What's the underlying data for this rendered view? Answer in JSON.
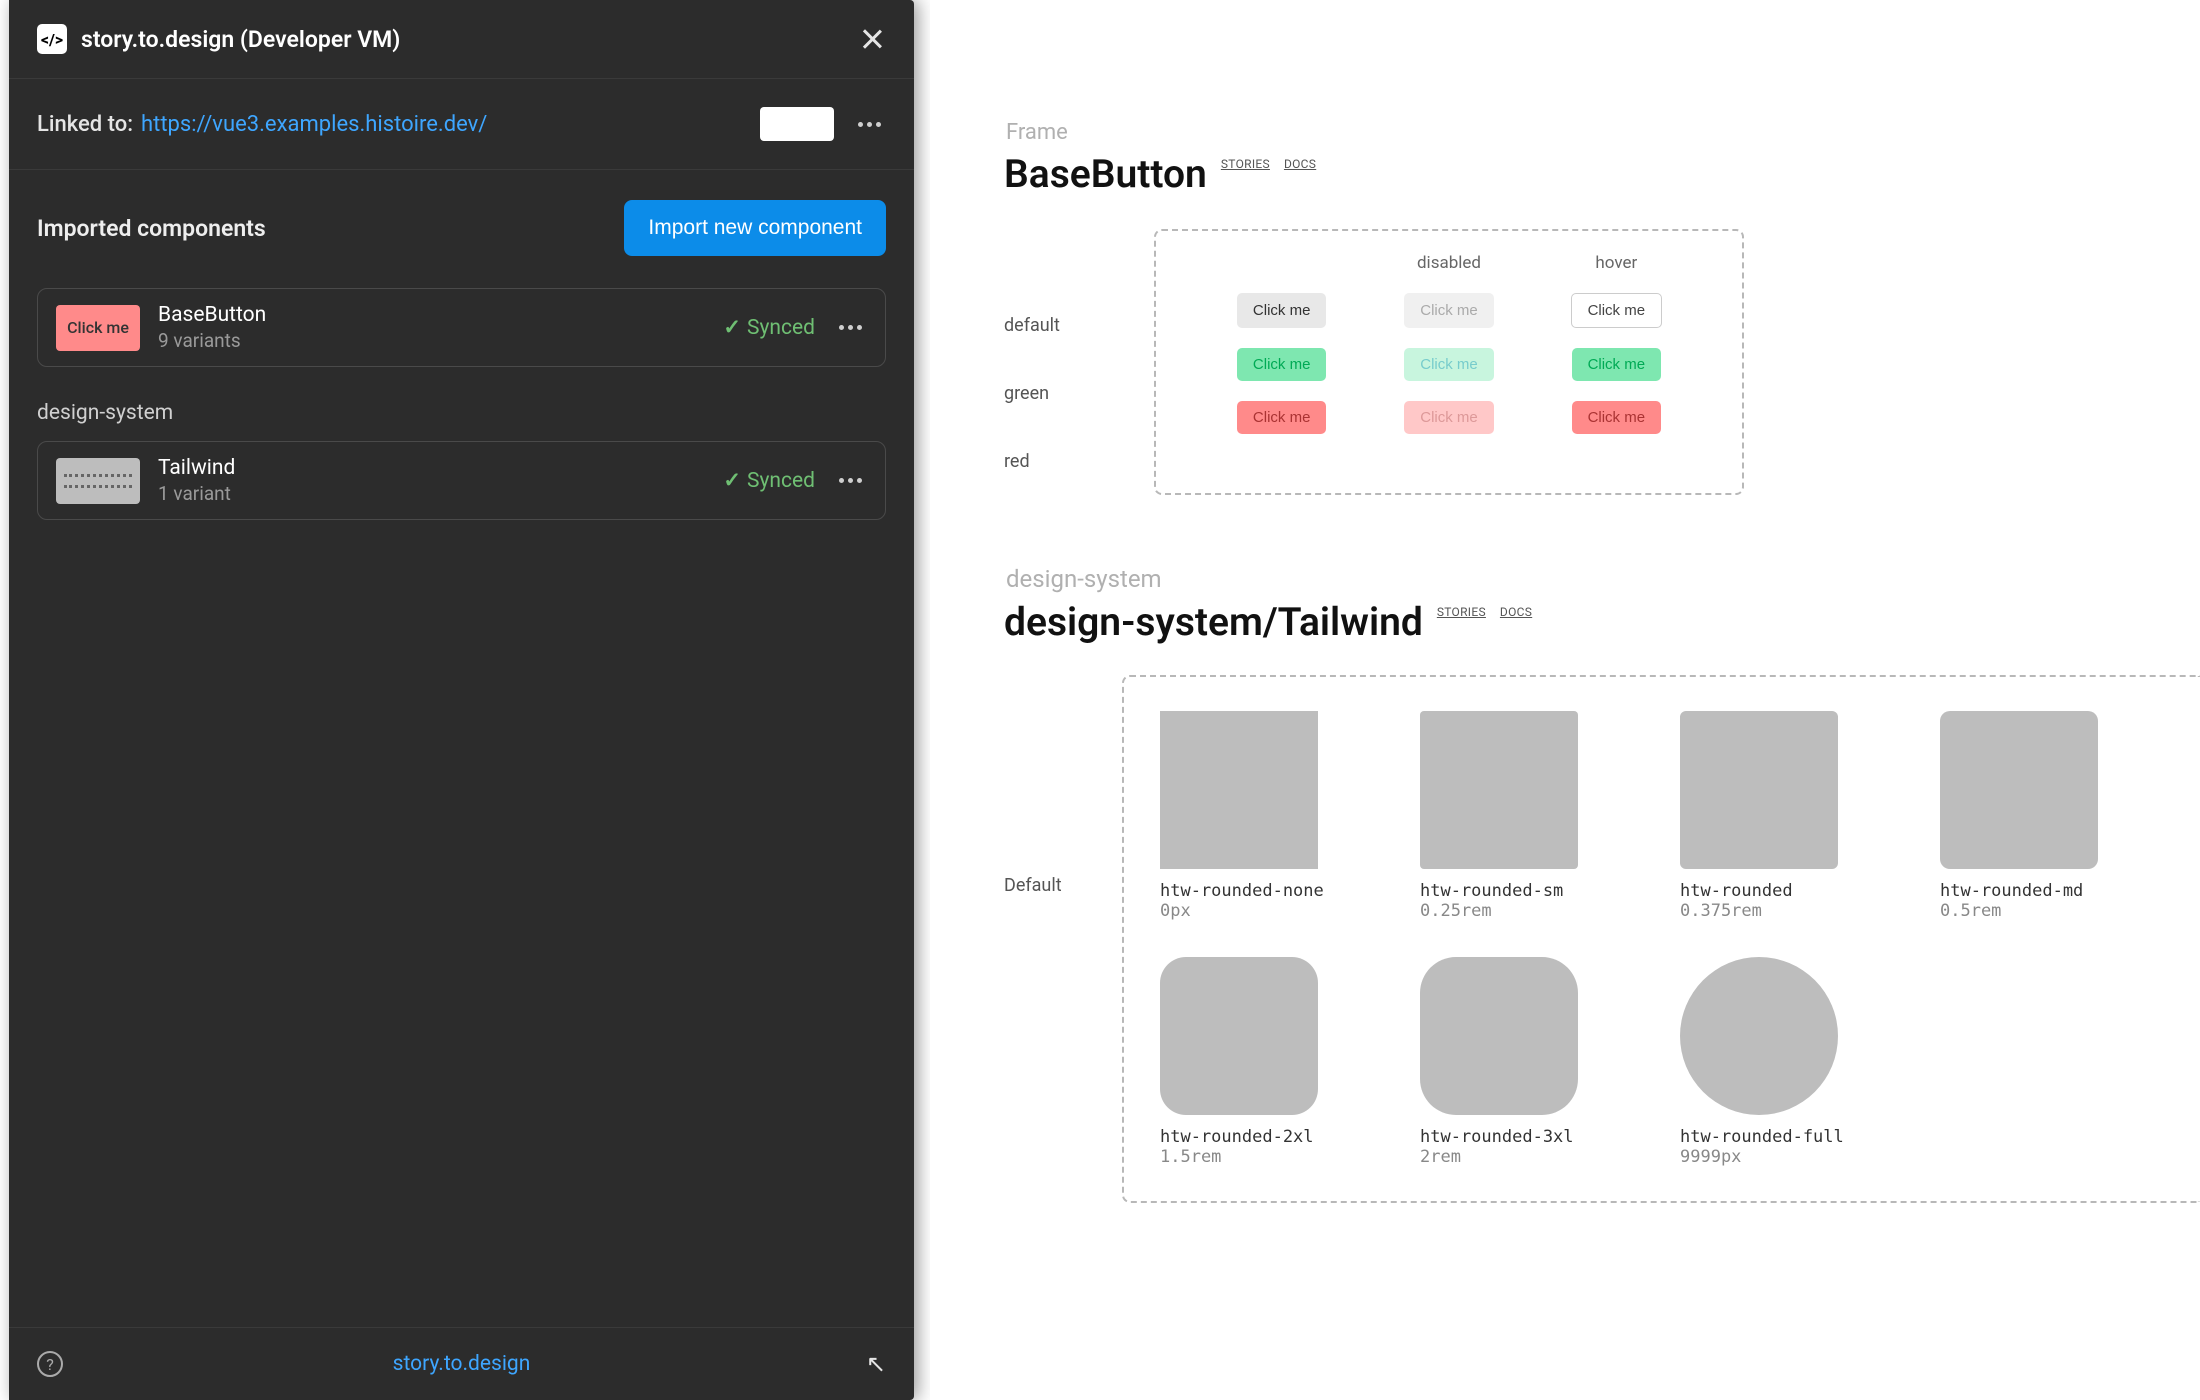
{
  "panel": {
    "app_icon_glyph": "</>",
    "title": "story.to.design (Developer VM)",
    "linked_label": "Linked to:",
    "linked_url": "https://vue3.examples.histoire.dev/",
    "imported_title": "Imported components",
    "import_button": "Import new component",
    "group_label": "design-system",
    "footer_link": "story.to.design",
    "components": [
      {
        "name": "BaseButton",
        "sub": "9 variants",
        "status": "Synced",
        "thumb_text": "Click me"
      },
      {
        "name": "Tailwind",
        "sub": "1 variant",
        "status": "Synced",
        "thumb_text": ""
      }
    ]
  },
  "canvas": {
    "frame_label": "Frame",
    "basebutton": {
      "title": "BaseButton",
      "badge_stories": "STORIES",
      "badge_docs": "DOCS",
      "col_headers": [
        "",
        "disabled",
        "hover"
      ],
      "row_labels": [
        "default",
        "green",
        "red"
      ],
      "button_text": "Click me"
    },
    "design_system": {
      "group_label": "design-system",
      "title": "design-system/Tailwind",
      "badge_stories": "STORIES",
      "badge_docs": "DOCS",
      "row_label": "Default",
      "swatches": [
        {
          "name": "htw-rounded-none",
          "val": "0px",
          "cls": "r-none"
        },
        {
          "name": "htw-rounded-sm",
          "val": "0.25rem",
          "cls": "r-sm"
        },
        {
          "name": "htw-rounded",
          "val": "0.375rem",
          "cls": "r"
        },
        {
          "name": "htw-rounded-md",
          "val": "0.5rem",
          "cls": "r-md"
        },
        {
          "name": "htw-rounded-2xl",
          "val": "1.5rem",
          "cls": "r-2xl"
        },
        {
          "name": "htw-rounded-3xl",
          "val": "2rem",
          "cls": "r-3xl"
        },
        {
          "name": "htw-rounded-full",
          "val": "9999px",
          "cls": "r-full"
        }
      ]
    }
  }
}
